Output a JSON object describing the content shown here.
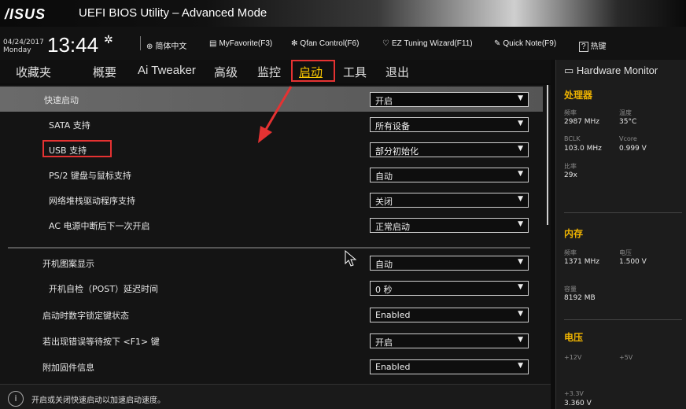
{
  "header": {
    "logo": "/ISUS",
    "title": "UEFI BIOS Utility – Advanced Mode",
    "date": "04/24/2017",
    "weekday": "Monday",
    "time": "13:44",
    "tools": [
      {
        "icon": "globe-icon",
        "label": "简体中文"
      },
      {
        "icon": "star-list-icon",
        "label": "MyFavorite(F3)"
      },
      {
        "icon": "fan-icon",
        "label": "Qfan Control(F6)"
      },
      {
        "icon": "bulb-icon",
        "label": "EZ Tuning Wizard(F11)"
      },
      {
        "icon": "note-icon",
        "label": "Quick Note(F9)"
      },
      {
        "icon": "help-icon",
        "label": "热键"
      }
    ]
  },
  "tabs": [
    {
      "label": "收藏夹"
    },
    {
      "label": "概要"
    },
    {
      "label": "Ai Tweaker"
    },
    {
      "label": "高级"
    },
    {
      "label": "监控"
    },
    {
      "label": "启动"
    },
    {
      "label": "工具"
    },
    {
      "label": "退出"
    }
  ],
  "settings": [
    {
      "label": "快速启动",
      "value": "开启"
    },
    {
      "label": "SATA 支持",
      "value": "所有设备"
    },
    {
      "label": "USB 支持",
      "value": "部分初始化"
    },
    {
      "label": "PS/2 键盘与鼠标支持",
      "value": "自动"
    },
    {
      "label": "网络堆栈驱动程序支持",
      "value": "关闭"
    },
    {
      "label": "AC 电源中断后下一次开启",
      "value": "正常启动"
    },
    {
      "label": "开机图案显示",
      "value": "自动"
    },
    {
      "label": "开机自检（POST）延迟时间",
      "value": "0 秒"
    },
    {
      "label": "启动时数字锁定键状态",
      "value": "Enabled"
    },
    {
      "label": "若出现错误等待按下 <F1> 键",
      "value": "开启"
    },
    {
      "label": "附加固件信息",
      "value": "Enabled"
    }
  ],
  "help": {
    "text": "开启或关闭快速启动以加速启动速度。"
  },
  "hardware_monitor": {
    "title": "Hardware Monitor",
    "cpu": {
      "section": "处理器",
      "freq_label": "频率",
      "freq": "2987 MHz",
      "temp_label": "温度",
      "temp": "35°C",
      "bclk_label": "BCLK",
      "bclk": "103.0 MHz",
      "vcore_label": "Vcore",
      "vcore": "0.999 V",
      "ratio_label": "比率",
      "ratio": "29x"
    },
    "memory": {
      "section": "内存",
      "freq_label": "频率",
      "freq": "1371 MHz",
      "volt_label": "电压",
      "volt": "1.500 V",
      "cap_label": "容量",
      "cap": "8192 MB"
    },
    "voltage": {
      "section": "电压",
      "v12_label": "+12V",
      "v5_label": "+5V",
      "v33_label": "+3.3V",
      "v33": "3.360 V"
    }
  },
  "colors": {
    "accent": "#ffcc00",
    "highlight": "#e53232",
    "section": "#f0b400"
  }
}
